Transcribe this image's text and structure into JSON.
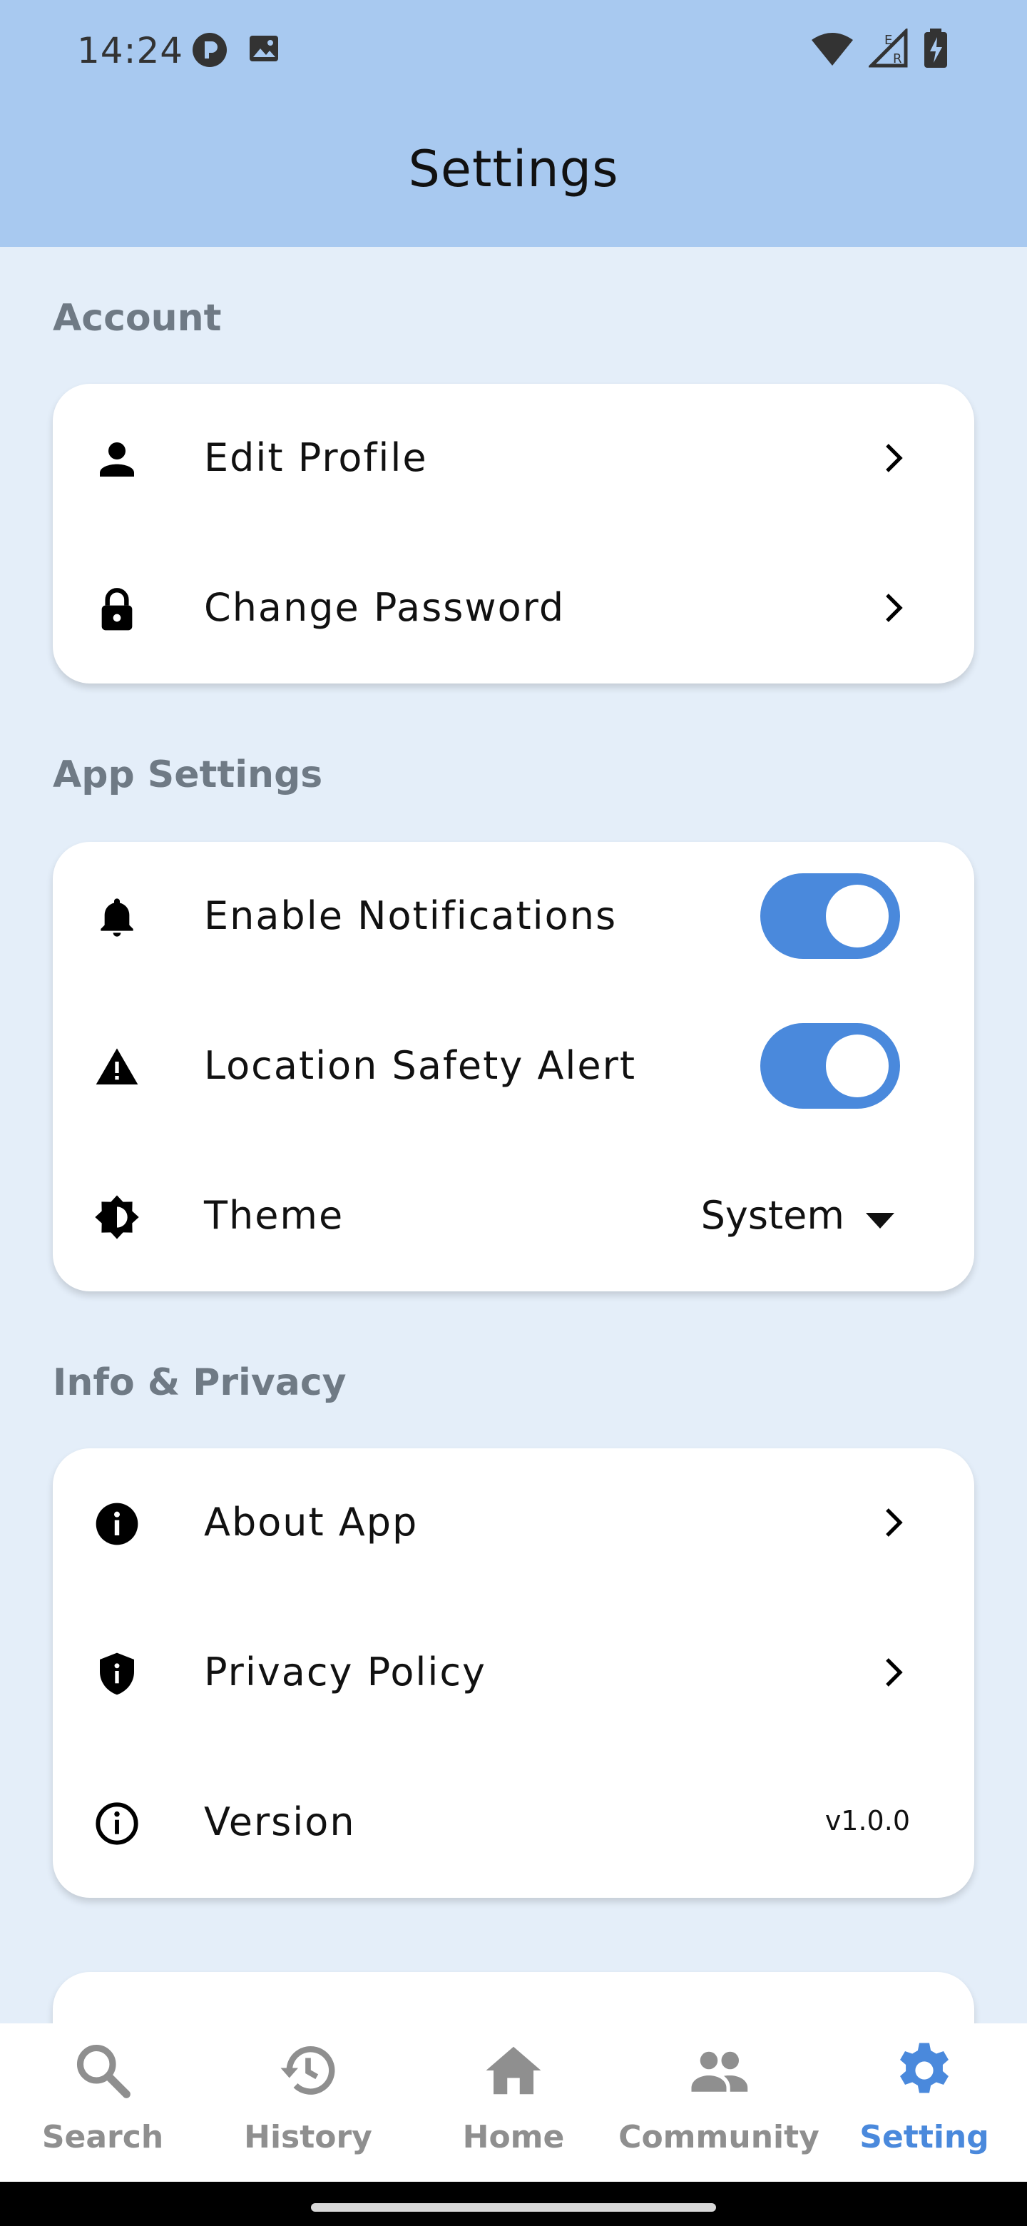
{
  "status_bar": {
    "time": "14:24"
  },
  "header": {
    "title": "Settings"
  },
  "sections": {
    "account": {
      "label": "Account",
      "items": [
        {
          "label": "Edit Profile",
          "icon": "person-icon"
        },
        {
          "label": "Change Password",
          "icon": "lock-icon"
        }
      ]
    },
    "app_settings": {
      "label": "App Settings",
      "items": [
        {
          "label": "Enable Notifications",
          "icon": "bell-icon",
          "toggle": true
        },
        {
          "label": "Location Safety Alert",
          "icon": "warning-icon",
          "toggle": true
        },
        {
          "label": "Theme",
          "icon": "brightness-icon",
          "value": "System"
        }
      ]
    },
    "info_privacy": {
      "label": "Info & Privacy",
      "items": [
        {
          "label": "About App",
          "icon": "info-filled-icon"
        },
        {
          "label": "Privacy Policy",
          "icon": "shield-icon"
        },
        {
          "label": "Version",
          "icon": "info-outline-icon",
          "value": "v1.0.0"
        }
      ]
    }
  },
  "bottom_nav": {
    "items": [
      {
        "label": "Search",
        "icon": "search-icon",
        "active": false
      },
      {
        "label": "History",
        "icon": "history-icon",
        "active": false
      },
      {
        "label": "Home",
        "icon": "home-icon",
        "active": false
      },
      {
        "label": "Community",
        "icon": "people-icon",
        "active": false
      },
      {
        "label": "Setting",
        "icon": "gear-icon",
        "active": true
      }
    ]
  },
  "colors": {
    "header_bg": "#A8C9F0",
    "page_bg": "#E4EEF9",
    "accent": "#4A89DC",
    "section_label": "#6F7A85",
    "nav_inactive": "#8F8F8F"
  }
}
